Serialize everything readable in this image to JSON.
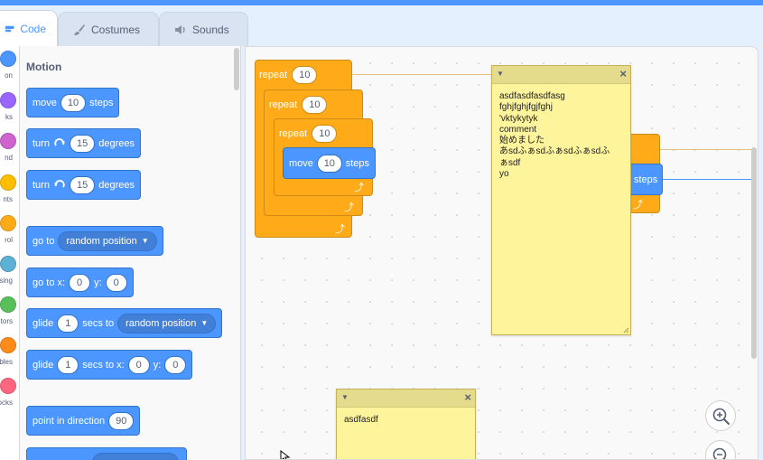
{
  "tabs": [
    {
      "label": "Code",
      "icon": "code-icon"
    },
    {
      "label": "Costumes",
      "icon": "paintbrush-icon"
    },
    {
      "label": "Sounds",
      "icon": "speaker-icon"
    }
  ],
  "categories": [
    {
      "label": "on",
      "color": "#4c97ff"
    },
    {
      "label": "ks",
      "color": "#9966ff"
    },
    {
      "label": "nd",
      "color": "#cf63cf"
    },
    {
      "label": "nts",
      "color": "#ffbf00"
    },
    {
      "label": "rol",
      "color": "#ffab19"
    },
    {
      "label": "sing",
      "color": "#5cb1d6"
    },
    {
      "label": "tors",
      "color": "#59c059"
    },
    {
      "label": "bles",
      "color": "#ff8c1a"
    },
    {
      "label": "ocks",
      "color": "#ff6680"
    }
  ],
  "palette": {
    "section_title": "Motion",
    "move": {
      "label": "move",
      "value": "10",
      "suffix": "steps"
    },
    "turn_right": {
      "label": "turn",
      "value": "15",
      "suffix": "degrees"
    },
    "turn_left": {
      "label": "turn",
      "value": "15",
      "suffix": "degrees"
    },
    "goto": {
      "label": "go to",
      "option": "random position"
    },
    "goto_xy": {
      "label": "go to x:",
      "x": "0",
      "ylabel": "y:",
      "y": "0"
    },
    "glide_to": {
      "label": "glide",
      "value": "1",
      "mid": "secs to",
      "option": "random position"
    },
    "glide_xy": {
      "label": "glide",
      "value": "1",
      "mid": "secs to x:",
      "x": "0",
      "ylabel": "y:",
      "y": "0"
    },
    "point_dir": {
      "label": "point in direction",
      "value": "90"
    }
  },
  "script": {
    "repeat_outer": {
      "label": "repeat",
      "value": "10"
    },
    "repeat_middle": {
      "label": "repeat",
      "value": "10"
    },
    "repeat_inner": {
      "label": "repeat",
      "value": "10"
    },
    "move": {
      "label": "move",
      "value": "10",
      "suffix": "steps"
    },
    "partial_steps": "steps"
  },
  "notes": [
    {
      "lines": [
        "asdfasdfasdfasg",
        "fghjfghjfgjfghj",
        "'vktykytyk",
        "comment",
        "始めました",
        "あsdふぁsdふぁsdふぁsdふ",
        "ぁsdf",
        "yo"
      ]
    },
    {
      "lines": [
        "asdfasdf"
      ]
    }
  ],
  "colors": {
    "motion": "#4c97ff",
    "control": "#ffab19",
    "note": "#fef49c",
    "accent": "#4c97ff"
  }
}
